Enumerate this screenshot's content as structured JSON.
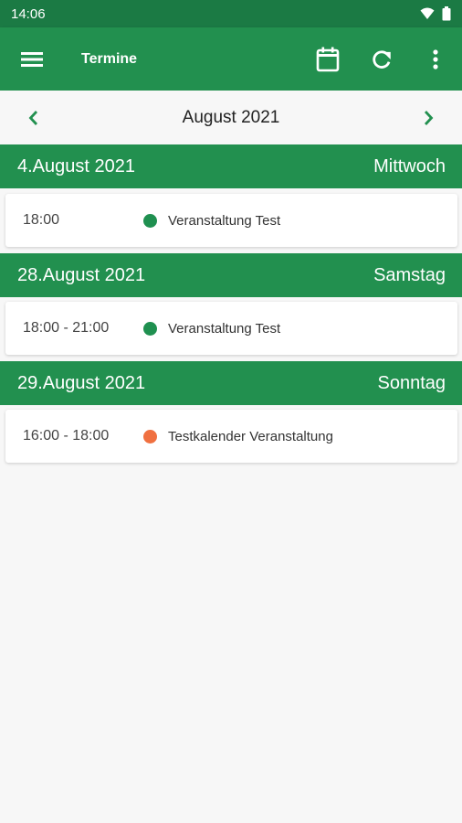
{
  "status_bar": {
    "time": "14:06",
    "icons": [
      "wifi-icon",
      "battery-icon"
    ]
  },
  "app_bar": {
    "title": "Termine",
    "icons": [
      "menu-icon",
      "calendar-icon",
      "refresh-icon",
      "more-vert-icon"
    ]
  },
  "month_nav": {
    "label": "August 2021",
    "icons": [
      "chevron-left-icon",
      "chevron-right-icon"
    ]
  },
  "days": [
    {
      "date": "4.August 2021",
      "weekday": "Mittwoch",
      "events": [
        {
          "time": "18:00",
          "title": "Veranstaltung Test",
          "color": "#1f9050"
        }
      ]
    },
    {
      "date": "28.August 2021",
      "weekday": "Samstag",
      "events": [
        {
          "time": "18:00 - 21:00",
          "title": "Veranstaltung Test",
          "color": "#1f9050"
        }
      ]
    },
    {
      "date": "29.August 2021",
      "weekday": "Sonntag",
      "events": [
        {
          "time": "16:00 - 18:00",
          "title": "Testkalender Veranstaltung",
          "color": "#f07040"
        }
      ]
    }
  ],
  "colors": {
    "status_bar": "#1b7a44",
    "primary": "#22904f",
    "background": "#f7f7f7"
  }
}
